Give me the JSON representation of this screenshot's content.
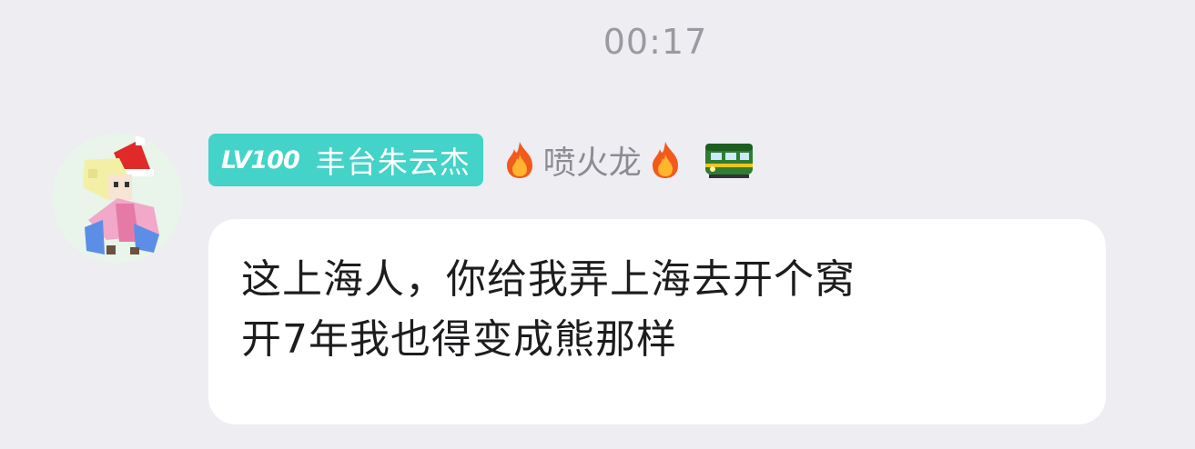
{
  "chat": {
    "timestamp": "00:17",
    "message": {
      "sender": {
        "level": "LV100",
        "name": "丰台朱云杰",
        "title": "喷火龙",
        "avatar_icon": "pixel-character-avatar",
        "badge_color": "#43d3c8"
      },
      "lines": [
        "这上海人，你给我弄上海去开个窝",
        "开7年我也得变成熊那样"
      ]
    }
  },
  "icons": {
    "flame": "flame-icon",
    "train": "green-train-icon"
  }
}
